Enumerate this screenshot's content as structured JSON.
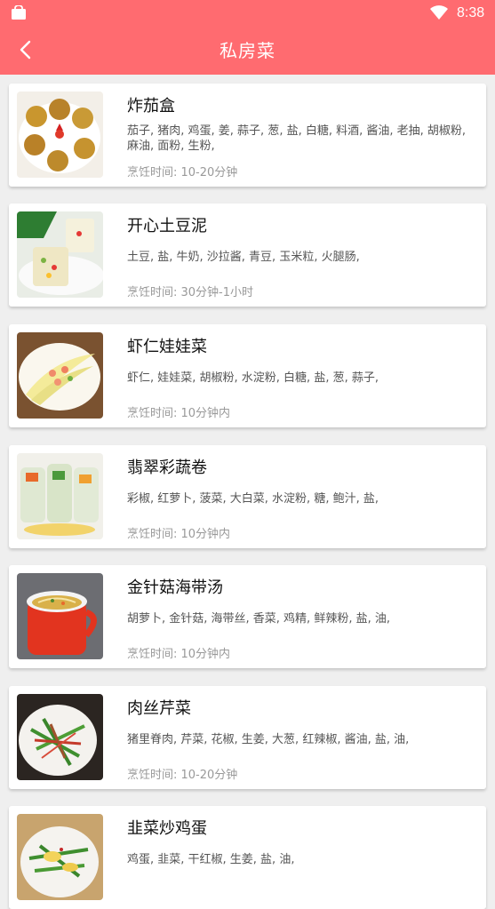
{
  "status_bar": {
    "time": "8:38",
    "left_icon": "bag-icon",
    "wifi_icon": "wifi-icon"
  },
  "app_bar": {
    "title": "私房菜",
    "back_icon": "back-arrow-icon"
  },
  "colors": {
    "accent": "#ff6b70",
    "background": "#efefef",
    "card": "#ffffff"
  },
  "recipes": [
    {
      "name": "炸茄盒",
      "ingredients": "茄子, 猪肉, 鸡蛋, 姜, 蒜子, 葱, 盐, 白糖, 料酒, 酱油, 老抽, 胡椒粉, 麻油, 面粉, 生粉,",
      "time": "烹饪时间: 10-20分钟"
    },
    {
      "name": "开心土豆泥",
      "ingredients": "土豆, 盐, 牛奶, 沙拉酱, 青豆, 玉米粒, 火腿肠,",
      "time": "烹饪时间: 30分钟-1小时"
    },
    {
      "name": "虾仁娃娃菜",
      "ingredients": "虾仁, 娃娃菜, 胡椒粉, 水淀粉, 白糖, 盐, 葱, 蒜子,",
      "time": "烹饪时间: 10分钟内"
    },
    {
      "name": "翡翠彩蔬卷",
      "ingredients": "彩椒, 红萝卜, 菠菜, 大白菜, 水淀粉, 糖, 鲍汁, 盐,",
      "time": "烹饪时间: 10分钟内"
    },
    {
      "name": "金针菇海带汤",
      "ingredients": "胡萝卜, 金针菇, 海带丝, 香菜, 鸡精, 鲜辣粉, 盐, 油,",
      "time": "烹饪时间: 10分钟内"
    },
    {
      "name": "肉丝芹菜",
      "ingredients": "猪里脊肉, 芹菜, 花椒, 生姜, 大葱, 红辣椒, 酱油, 盐, 油,",
      "time": "烹饪时间: 10-20分钟"
    },
    {
      "name": "韭菜炒鸡蛋",
      "ingredients": "鸡蛋, 韭菜, 干红椒, 生姜, 盐, 油,",
      "time": ""
    }
  ]
}
